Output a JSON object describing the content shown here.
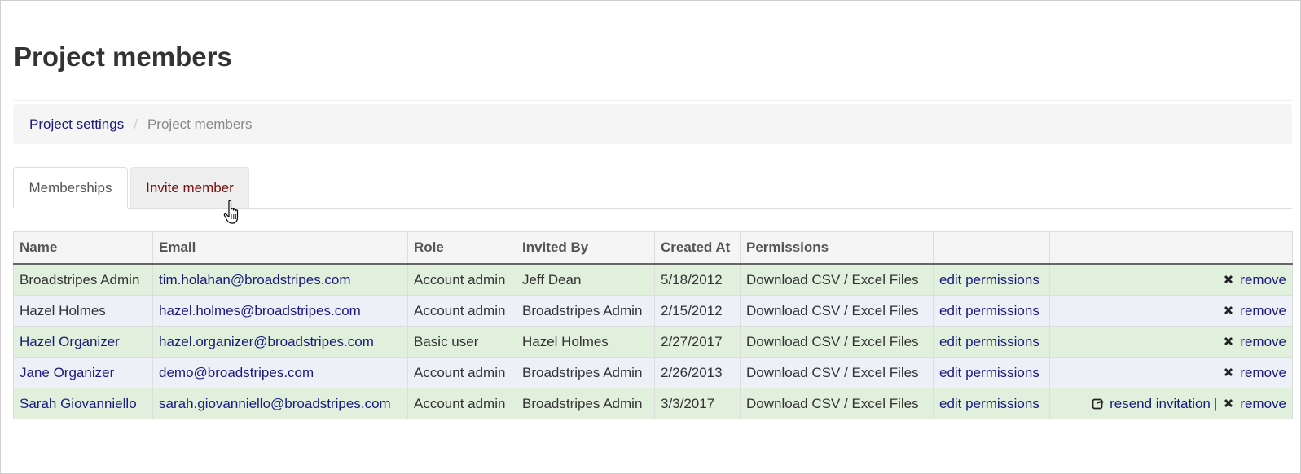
{
  "page": {
    "title": "Project members"
  },
  "breadcrumb": {
    "parent": "Project settings",
    "separator": "/",
    "current": "Project members"
  },
  "tabs": [
    {
      "label": "Memberships",
      "state": "active"
    },
    {
      "label": "Invite member",
      "state": "hover"
    }
  ],
  "table": {
    "headers": [
      "Name",
      "Email",
      "Role",
      "Invited By",
      "Created At",
      "Permissions",
      "",
      ""
    ],
    "rows": [
      {
        "name": "Broadstripes Admin",
        "email": "tim.holahan@broadstripes.com",
        "role": "Account admin",
        "invited_by": "Jeff Dean",
        "created_at": "5/18/2012",
        "permissions": "Download CSV / Excel Files",
        "edit": "edit permissions",
        "remove": "remove"
      },
      {
        "name": "Hazel Holmes",
        "email": "hazel.holmes@broadstripes.com",
        "role": "Account admin",
        "invited_by": "Broadstripes Admin",
        "created_at": "2/15/2012",
        "permissions": "Download CSV / Excel Files",
        "edit": "edit permissions",
        "remove": "remove"
      },
      {
        "name": "Hazel Organizer",
        "email": "hazel.organizer@broadstripes.com",
        "role": "Basic user",
        "invited_by": "Hazel Holmes",
        "created_at": "2/27/2017",
        "permissions": "Download CSV / Excel Files",
        "edit": "edit permissions",
        "remove": "remove"
      },
      {
        "name": "Jane Organizer",
        "email": "demo@broadstripes.com",
        "role": "Account admin",
        "invited_by": "Broadstripes Admin",
        "created_at": "2/26/2013",
        "permissions": "Download CSV / Excel Files",
        "edit": "edit permissions",
        "remove": "remove"
      },
      {
        "name": "Sarah Giovanniello",
        "email": "sarah.giovanniello@broadstripes.com",
        "role": "Account admin",
        "invited_by": "Broadstripes Admin",
        "created_at": "3/3/2017",
        "permissions": "Download CSV / Excel Files",
        "edit": "edit permissions",
        "resend": "resend invitation",
        "pipe": "|",
        "remove": "remove"
      }
    ]
  },
  "icons": {
    "remove": "times-icon",
    "resend": "share-icon",
    "cursor": "hand-pointer-icon"
  },
  "colors": {
    "link": "#1a1a80",
    "tab_hover_text": "#7a1010",
    "row_green": "#e1efdd",
    "row_blue": "#eef0f8"
  }
}
